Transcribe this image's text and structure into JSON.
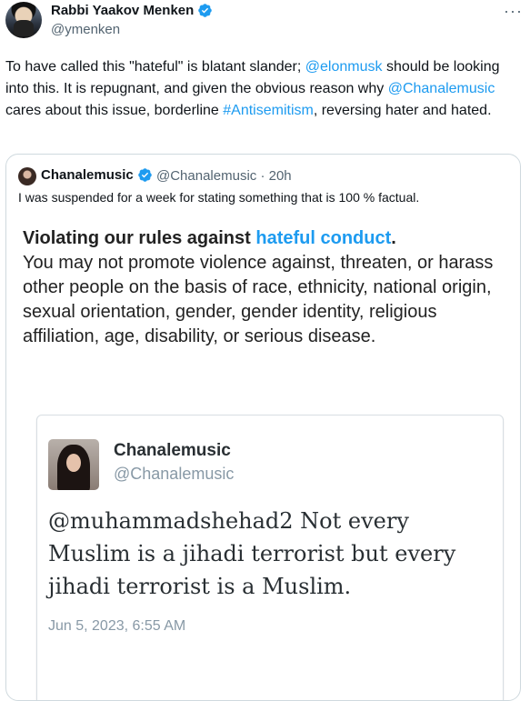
{
  "tweet": {
    "author_name": "Rabbi Yaakov Menken",
    "handle": "@ymenken",
    "more_label": "···",
    "text_parts": {
      "p1": "To have called this \"hateful\" is blatant slander; ",
      "mention1": "@elonmusk",
      "p2": " should be looking into this. It is repugnant, and given the obvious reason why ",
      "mention2": "@Chanalemusic",
      "p3": " cares about this issue, borderline ",
      "hashtag": "#Antisemitism",
      "p4": ", reversing hater and hated."
    }
  },
  "quoted": {
    "author_name": "Chanalemusic",
    "handle": "@Chanalemusic",
    "time": "20h",
    "meta_sep": "·",
    "text": "I was suspended for a week for stating something that is 100 % factual.",
    "policy": {
      "heading_prefix": "Violating our rules against ",
      "heading_link": "hateful conduct",
      "heading_suffix": ".",
      "body": "You may not promote violence against, threaten, or harass other people on the basis of race, ethnicity, national origin, sexual orientation, gender, gender identity, religious affiliation, age, disability, or serious disease."
    },
    "embedded": {
      "name": "Chanalemusic",
      "handle": "@Chanalemusic",
      "text": "@muhammadshehad2 Not every Muslim is a jihadi terrorist but every jihadi terrorist is a Muslim.",
      "date": "Jun 5, 2023, 6:55 AM"
    }
  },
  "icons": {
    "verified": "verified-badge-icon",
    "more": "more-options-icon"
  },
  "colors": {
    "accent": "#1d9bf0",
    "text": "#0f1419",
    "muted": "#536471",
    "border": "#cfd9de"
  }
}
